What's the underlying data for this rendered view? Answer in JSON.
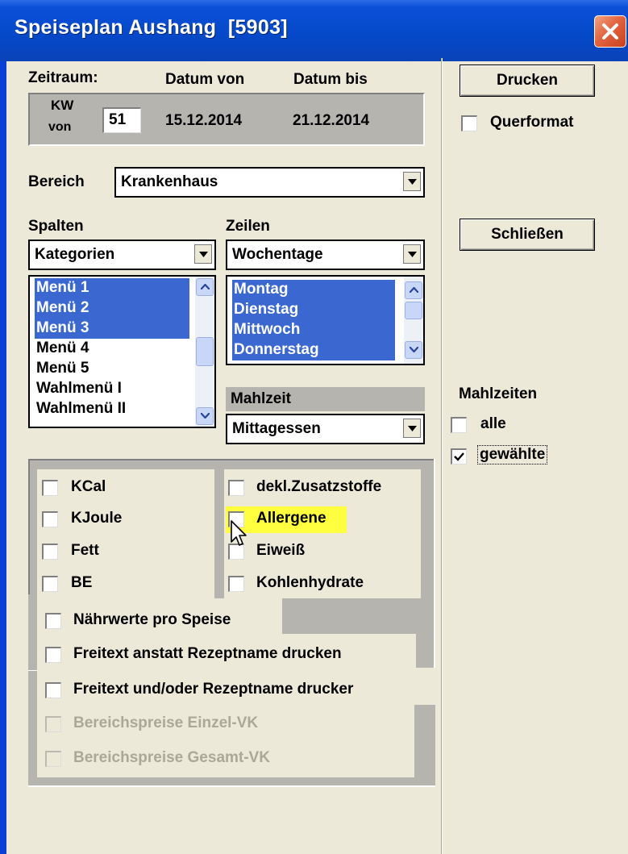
{
  "window": {
    "title": "Speiseplan Aushang  [5903]"
  },
  "zeitraum": {
    "label": "Zeitraum:",
    "datum_von_label": "Datum von",
    "datum_bis_label": "Datum bis",
    "kw_label": "KW",
    "von_label": "von",
    "kw_value": "51",
    "datum_von": "15.12.2014",
    "datum_bis": "21.12.2014"
  },
  "bereich": {
    "label": "Bereich",
    "value": "Krankenhaus"
  },
  "spalten": {
    "label": "Spalten",
    "combo_value": "Kategorien",
    "items": [
      {
        "label": "Menü 1",
        "selected": true
      },
      {
        "label": "Menü 2",
        "selected": true
      },
      {
        "label": "Menü 3",
        "selected": true
      },
      {
        "label": "Menü 4",
        "selected": false
      },
      {
        "label": "Menü 5",
        "selected": false
      },
      {
        "label": "Wahlmenü I",
        "selected": false
      },
      {
        "label": "Wahlmenü II",
        "selected": false
      }
    ]
  },
  "zeilen": {
    "label": "Zeilen",
    "combo_value": "Wochentage",
    "items": [
      {
        "label": "Montag",
        "selected": true
      },
      {
        "label": "Dienstag",
        "selected": true
      },
      {
        "label": "Mittwoch",
        "selected": true
      },
      {
        "label": "Donnerstag",
        "selected": true
      }
    ]
  },
  "mahlzeit": {
    "label": "Mahlzeit",
    "value": "Mittagessen"
  },
  "options": {
    "kcal": {
      "label": "KCal",
      "checked": false
    },
    "kjoule": {
      "label": "KJoule",
      "checked": false
    },
    "fett": {
      "label": "Fett",
      "checked": false
    },
    "be": {
      "label": "BE",
      "checked": false
    },
    "zusatzstoffe": {
      "label": "dekl.Zusatzstoffe",
      "checked": false
    },
    "allergene": {
      "label": "Allergene",
      "checked": false,
      "highlight": "#FFFF40"
    },
    "eiweiss": {
      "label": "Eiweiß",
      "checked": false
    },
    "kohlenhydrate": {
      "label": "Kohlenhydrate",
      "checked": false
    },
    "naehrwerte": {
      "label": "Nährwerte pro Speise",
      "checked": false
    },
    "freitext_anstatt": {
      "label": "Freitext anstatt Rezeptname drucken",
      "checked": false
    },
    "freitext_und": {
      "label": "Freitext und/oder Rezeptname drucker",
      "checked": false
    },
    "einzel_vk": {
      "label": "Bereichspreise Einzel-VK",
      "checked": false,
      "disabled": true
    },
    "gesamt_vk": {
      "label": "Bereichspreise Gesamt-VK",
      "checked": false,
      "disabled": true
    }
  },
  "right": {
    "drucken_label": "Drucken",
    "querformat": {
      "label": "Querformat",
      "checked": false
    },
    "schliessen_label": "Schließen",
    "mahlzeiten_label": "Mahlzeiten",
    "alle": {
      "label": "alle",
      "checked": false
    },
    "gewaehlte": {
      "label": "gewählte",
      "checked": true
    }
  },
  "colors": {
    "titlebar": "#0548C8",
    "selection": "#3A68D0",
    "dialog": "#ECE9D8",
    "panel": "#B6B4AE"
  }
}
